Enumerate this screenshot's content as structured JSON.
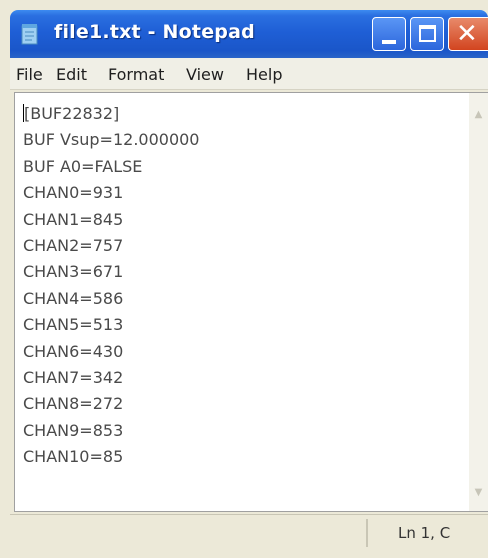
{
  "window": {
    "title": "file1.txt - Notepad",
    "colors": {
      "titlebar": "#1f5fd6",
      "close_button": "#d2441f",
      "background": "#ece9d8"
    }
  },
  "menu": {
    "items": [
      {
        "label": "File"
      },
      {
        "label": "Edit"
      },
      {
        "label": "Format"
      },
      {
        "label": "View"
      },
      {
        "label": "Help"
      }
    ]
  },
  "document": {
    "lines": [
      "[BUF22832]",
      "BUF Vsup=12.000000",
      "BUF A0=FALSE",
      "CHAN0=931",
      "CHAN1=845",
      "CHAN2=757",
      "CHAN3=671",
      "CHAN4=586",
      "CHAN5=513",
      "CHAN6=430",
      "CHAN7=342",
      "CHAN8=272",
      "CHAN9=853",
      "CHAN10=85"
    ]
  },
  "status": {
    "position": "Ln 1, C"
  },
  "icons": {
    "app": "notepad-icon",
    "minimize": "minimize-icon",
    "maximize": "maximize-icon",
    "close": "close-icon"
  }
}
